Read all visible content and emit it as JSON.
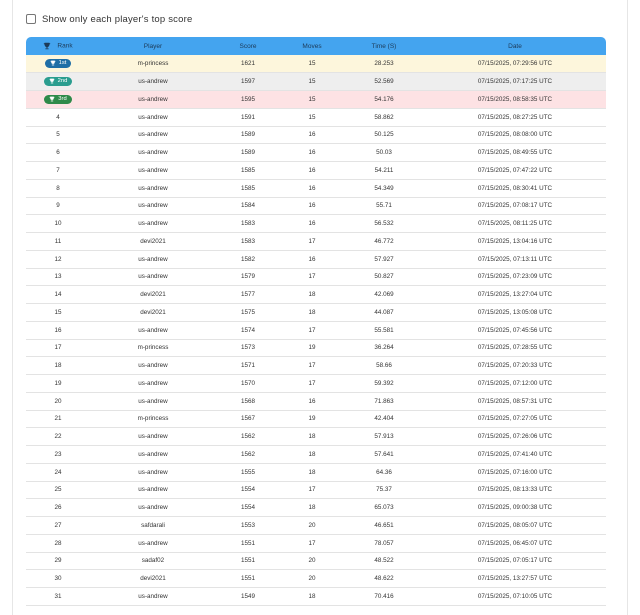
{
  "filter": {
    "label": "Show only each player's top score",
    "checked": false
  },
  "colors": {
    "header_bg": "#44a4ef",
    "gold_row": "#fdf6dc",
    "silver_row": "#eeeeee",
    "bronze_row": "#fde2e4",
    "badge_1st": "#1f6ea6",
    "badge_2nd": "#2a9d8f",
    "badge_3rd": "#2f8a4a"
  },
  "table": {
    "headers": [
      "Rank",
      "Player",
      "Score",
      "Moves",
      "Time (S)",
      "Date"
    ],
    "rows": [
      {
        "rank": "1st",
        "player": "m-princess",
        "score": "1621",
        "moves": "15",
        "time": "28.253",
        "date": "07/15/2025, 07:29:56 UTC"
      },
      {
        "rank": "2nd",
        "player": "us-andrew",
        "score": "1597",
        "moves": "15",
        "time": "52.569",
        "date": "07/15/2025, 07:17:25 UTC"
      },
      {
        "rank": "3rd",
        "player": "us-andrew",
        "score": "1595",
        "moves": "15",
        "time": "54.176",
        "date": "07/15/2025, 08:58:35 UTC"
      },
      {
        "rank": "4",
        "player": "us-andrew",
        "score": "1591",
        "moves": "15",
        "time": "58.862",
        "date": "07/15/2025, 08:27:25 UTC"
      },
      {
        "rank": "5",
        "player": "us-andrew",
        "score": "1589",
        "moves": "16",
        "time": "50.125",
        "date": "07/15/2025, 08:08:00 UTC"
      },
      {
        "rank": "6",
        "player": "us-andrew",
        "score": "1589",
        "moves": "16",
        "time": "50.03",
        "date": "07/15/2025, 08:49:55 UTC"
      },
      {
        "rank": "7",
        "player": "us-andrew",
        "score": "1585",
        "moves": "16",
        "time": "54.211",
        "date": "07/15/2025, 07:47:22 UTC"
      },
      {
        "rank": "8",
        "player": "us-andrew",
        "score": "1585",
        "moves": "16",
        "time": "54.349",
        "date": "07/15/2025, 08:30:41 UTC"
      },
      {
        "rank": "9",
        "player": "us-andrew",
        "score": "1584",
        "moves": "16",
        "time": "55.71",
        "date": "07/15/2025, 07:08:17 UTC"
      },
      {
        "rank": "10",
        "player": "us-andrew",
        "score": "1583",
        "moves": "16",
        "time": "56.532",
        "date": "07/15/2025, 08:11:25 UTC"
      },
      {
        "rank": "11",
        "player": "devi2021",
        "score": "1583",
        "moves": "17",
        "time": "46.772",
        "date": "07/15/2025, 13:04:16 UTC"
      },
      {
        "rank": "12",
        "player": "us-andrew",
        "score": "1582",
        "moves": "16",
        "time": "57.927",
        "date": "07/15/2025, 07:13:11 UTC"
      },
      {
        "rank": "13",
        "player": "us-andrew",
        "score": "1579",
        "moves": "17",
        "time": "50.827",
        "date": "07/15/2025, 07:23:09 UTC"
      },
      {
        "rank": "14",
        "player": "devi2021",
        "score": "1577",
        "moves": "18",
        "time": "42.069",
        "date": "07/15/2025, 13:27:04 UTC"
      },
      {
        "rank": "15",
        "player": "devi2021",
        "score": "1575",
        "moves": "18",
        "time": "44.087",
        "date": "07/15/2025, 13:05:08 UTC"
      },
      {
        "rank": "16",
        "player": "us-andrew",
        "score": "1574",
        "moves": "17",
        "time": "55.581",
        "date": "07/15/2025, 07:45:56 UTC"
      },
      {
        "rank": "17",
        "player": "m-princess",
        "score": "1573",
        "moves": "19",
        "time": "36.264",
        "date": "07/15/2025, 07:28:55 UTC"
      },
      {
        "rank": "18",
        "player": "us-andrew",
        "score": "1571",
        "moves": "17",
        "time": "58.66",
        "date": "07/15/2025, 07:20:33 UTC"
      },
      {
        "rank": "19",
        "player": "us-andrew",
        "score": "1570",
        "moves": "17",
        "time": "59.392",
        "date": "07/15/2025, 07:12:00 UTC"
      },
      {
        "rank": "20",
        "player": "us-andrew",
        "score": "1568",
        "moves": "16",
        "time": "71.863",
        "date": "07/15/2025, 08:57:31 UTC"
      },
      {
        "rank": "21",
        "player": "m-princess",
        "score": "1567",
        "moves": "19",
        "time": "42.404",
        "date": "07/15/2025, 07:27:05 UTC"
      },
      {
        "rank": "22",
        "player": "us-andrew",
        "score": "1562",
        "moves": "18",
        "time": "57.913",
        "date": "07/15/2025, 07:26:06 UTC"
      },
      {
        "rank": "23",
        "player": "us-andrew",
        "score": "1562",
        "moves": "18",
        "time": "57.641",
        "date": "07/15/2025, 07:41:40 UTC"
      },
      {
        "rank": "24",
        "player": "us-andrew",
        "score": "1555",
        "moves": "18",
        "time": "64.36",
        "date": "07/15/2025, 07:16:00 UTC"
      },
      {
        "rank": "25",
        "player": "us-andrew",
        "score": "1554",
        "moves": "17",
        "time": "75.37",
        "date": "07/15/2025, 08:13:33 UTC"
      },
      {
        "rank": "26",
        "player": "us-andrew",
        "score": "1554",
        "moves": "18",
        "time": "65.073",
        "date": "07/15/2025, 09:00:38 UTC"
      },
      {
        "rank": "27",
        "player": "safdarali",
        "score": "1553",
        "moves": "20",
        "time": "46.651",
        "date": "07/15/2025, 08:05:07 UTC"
      },
      {
        "rank": "28",
        "player": "us-andrew",
        "score": "1551",
        "moves": "17",
        "time": "78.057",
        "date": "07/15/2025, 06:45:07 UTC"
      },
      {
        "rank": "29",
        "player": "sadaf02",
        "score": "1551",
        "moves": "20",
        "time": "48.522",
        "date": "07/15/2025, 07:05:17 UTC"
      },
      {
        "rank": "30",
        "player": "devi2021",
        "score": "1551",
        "moves": "20",
        "time": "48.622",
        "date": "07/15/2025, 13:27:57 UTC"
      },
      {
        "rank": "31",
        "player": "us-andrew",
        "score": "1549",
        "moves": "18",
        "time": "70.416",
        "date": "07/15/2025, 07:10:05 UTC"
      }
    ]
  }
}
